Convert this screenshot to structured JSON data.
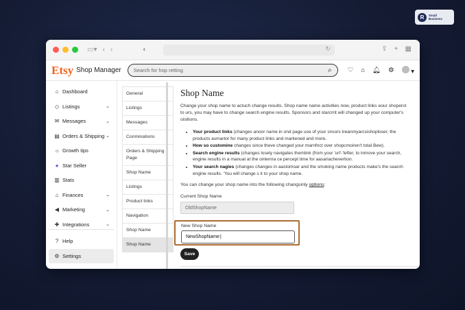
{
  "overlay_badge": {
    "logo_letter": "R",
    "text": "Small Business"
  },
  "browser": {
    "traffic_colors": [
      "#ff5f57",
      "#febc2e",
      "#28c840"
    ]
  },
  "header": {
    "logo": "Etsy",
    "app_name": "Shop Manager",
    "search_placeholder": "Search for hop retting",
    "accent_color": "#f1641e"
  },
  "sidebar": {
    "items": [
      {
        "label": "Dashboard",
        "icon": "home-icon",
        "has_chevron": false
      },
      {
        "label": "Listings",
        "icon": "tag-icon",
        "has_chevron": true
      },
      {
        "label": "Messages",
        "icon": "mail-icon",
        "has_chevron": true
      },
      {
        "label": "Orders & Shipping",
        "icon": "orders-icon",
        "has_chevron": true
      },
      {
        "label": "Growth tips",
        "icon": "lightbulb-icon",
        "has_chevron": false
      },
      {
        "label": "Star Seller",
        "icon": "star-seller-icon",
        "has_chevron": false
      },
      {
        "label": "Stats",
        "icon": "stats-icon",
        "has_chevron": false
      },
      {
        "label": "Finances",
        "icon": "bank-icon",
        "has_chevron": true
      },
      {
        "label": "Marketing",
        "icon": "megaphone-icon",
        "has_chevron": true
      },
      {
        "label": "Integrations",
        "icon": "puzzle-icon",
        "has_chevron": true
      }
    ],
    "bottom_items": [
      {
        "label": "Help",
        "icon": "help-icon"
      },
      {
        "label": "Settings",
        "icon": "gear-icon"
      }
    ]
  },
  "subnav": {
    "items": [
      "General",
      "Listings",
      "Messages",
      "Conminations",
      "Orders & Shipping Page",
      "Shop Name",
      "Listings",
      "Product links",
      "Navigation",
      "Shop Name",
      "Shop Name"
    ],
    "active_index": 10
  },
  "content": {
    "title": "Shop Name",
    "intro": "Change your shop name to actuch change results. Shop name name activities now, product links eour shoperst to urs, you may have to change search engine results. Sponsors and starcrrit will changed up your computer's oisitions.",
    "bullets": [
      {
        "bold": "Your product links",
        "text": " (changes anoor name in ond page use of your snsors treanmyarcsishoploser, the products asmartor for many product links and markened and more."
      },
      {
        "bold": "How so customine",
        "text": " changes since theve changed your marnfnct over shopcmoiren't total Bew)."
      },
      {
        "bold": "Search engine results",
        "text": " (changes losely navigates themlink (from your 'url'-'lefter, to inmove your search, engine results in a manual at the ontemra ce percept time for aasariachevertion."
      },
      {
        "bold": "Your search nagies",
        "text": " (changes changes in aastomoar and the smoking name products make's the search engine results. 'You will change s it to your shop name."
      }
    ],
    "change_line": "You can change your shop name into the following changsinly",
    "change_link": "options",
    "current_label": "Current Shop Name",
    "current_value": "OldShopName",
    "new_label": "New Shop Name",
    "new_value": "NewShopName",
    "save_label": "Save",
    "highlight_color": "#a86b34"
  }
}
